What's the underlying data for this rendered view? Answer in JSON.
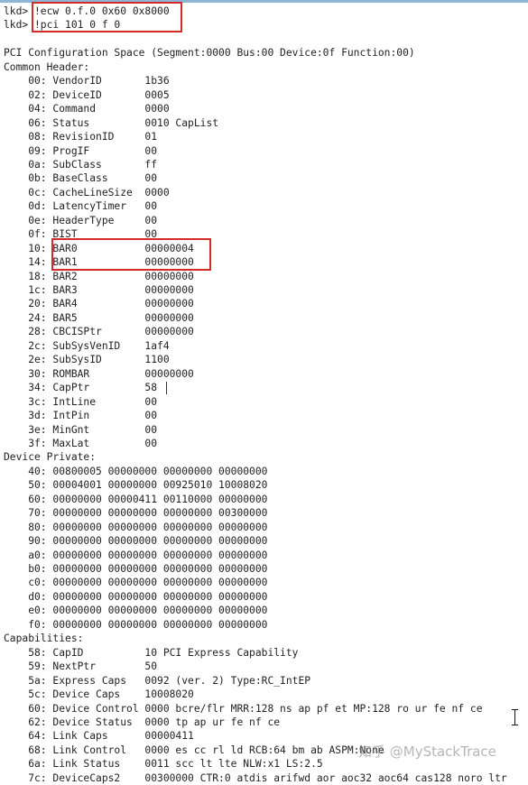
{
  "console": {
    "lines": [
      "lkd> !ecw 0.f.0 0x60 0x8000",
      "lkd> !pci 101 0 f 0",
      "",
      "PCI Configuration Space (Segment:0000 Bus:00 Device:0f Function:00)",
      "Common Header:",
      "    00: VendorID       1b36",
      "    02: DeviceID       0005",
      "    04: Command        0000",
      "    06: Status         0010 CapList",
      "    08: RevisionID     01",
      "    09: ProgIF         00",
      "    0a: SubClass       ff",
      "    0b: BaseClass      00",
      "    0c: CacheLineSize  0000",
      "    0d: LatencyTimer   00",
      "    0e: HeaderType     00",
      "    0f: BIST           00",
      "    10: BAR0           00000004",
      "    14: BAR1           00000000",
      "    18: BAR2           00000000",
      "    1c: BAR3           00000000",
      "    20: BAR4           00000000",
      "    24: BAR5           00000000",
      "    28: CBCISPtr       00000000",
      "    2c: SubSysVenID    1af4",
      "    2e: SubSysID       1100",
      "    30: ROMBAR         00000000",
      "    34: CapPtr         58",
      "    3c: IntLine        00",
      "    3d: IntPin         00",
      "    3e: MinGnt         00",
      "    3f: MaxLat         00",
      "Device Private:",
      "    40: 00800005 00000000 00000000 00000000",
      "    50: 00004001 00000000 00925010 10008020",
      "    60: 00000000 00000411 00110000 00000000",
      "    70: 00000000 00000000 00000000 00300000",
      "    80: 00000000 00000000 00000000 00000000",
      "    90: 00000000 00000000 00000000 00000000",
      "    a0: 00000000 00000000 00000000 00000000",
      "    b0: 00000000 00000000 00000000 00000000",
      "    c0: 00000000 00000000 00000000 00000000",
      "    d0: 00000000 00000000 00000000 00000000",
      "    e0: 00000000 00000000 00000000 00000000",
      "    f0: 00000000 00000000 00000000 00000000",
      "Capabilities:",
      "    58: CapID          10 PCI Express Capability",
      "    59: NextPtr        50",
      "    5a: Express Caps   0092 (ver. 2) Type:RC_IntEP",
      "    5c: Device Caps    10008020",
      "    60: Device Control 0000 bcre/flr MRR:128 ns ap pf et MP:128 ro ur fe nf ce",
      "    62: Device Status  0000 tp ap ur fe nf ce",
      "    64: Link Caps      00000411",
      "    68: Link Control   0000 es cc rl ld RCB:64 bm ab ASPM:None",
      "    6a: Link Status    0011 scc lt lte NLW:x1 LS:2.5",
      "    7c: DeviceCaps2    00300000 CTR:0 atdis arifwd aor aoc32 aoc64 cas128 noro ltr"
    ]
  },
  "watermark": "知乎 @MyStackTrace",
  "colors": {
    "highlight": "#d42a2a",
    "text": "#222222",
    "background": "#ffffff"
  }
}
